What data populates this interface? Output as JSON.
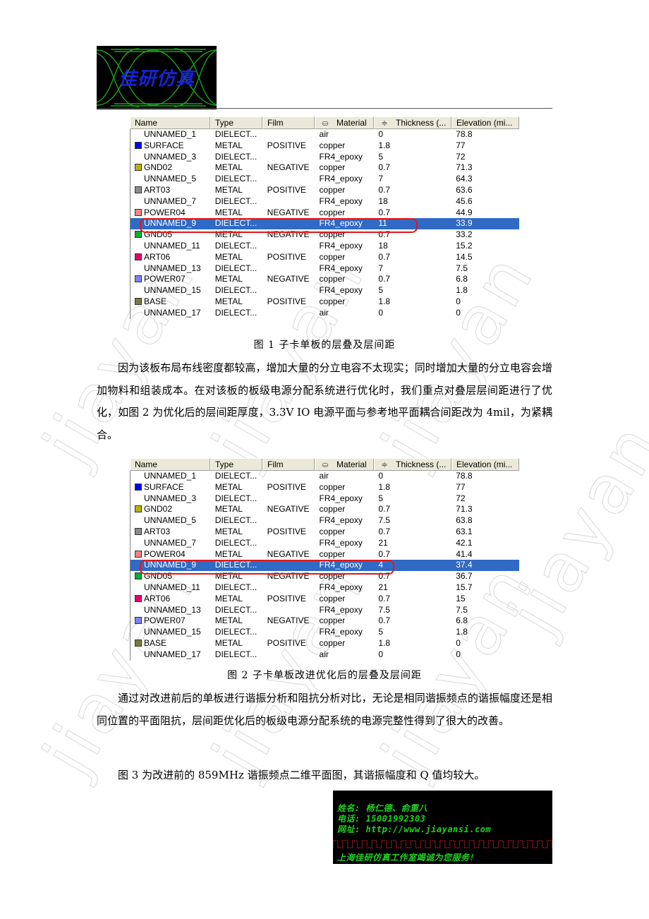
{
  "watermark": {
    "text": "jiayan",
    "color": "#d8d8d8"
  },
  "logo": {
    "text": "佳研仿真",
    "text_color": "#1a22d8",
    "curve_color": "#1fb51f"
  },
  "table_columns": {
    "name": "Name",
    "type": "Type",
    "film": "Film",
    "material": "Material",
    "material_icon": "paint-bucket-icon",
    "thickness": "Thickness (...",
    "thickness_icon": "layer-thickness-icon",
    "elevation": "Elevation (mi..."
  },
  "figure1": {
    "caption": "图 1  子卡单板的层叠及层间距",
    "selected_row": 8,
    "rows": [
      {
        "name": "UNNAMED_1",
        "type": "DIELECT...",
        "film": "",
        "material": "air",
        "thickness": "0",
        "elevation": "78.8",
        "color": ""
      },
      {
        "name": "SURFACE",
        "type": "METAL",
        "film": "POSITIVE",
        "material": "copper",
        "thickness": "1.8",
        "elevation": "77",
        "color": "#0000ff"
      },
      {
        "name": "UNNAMED_3",
        "type": "DIELECT...",
        "film": "",
        "material": "FR4_epoxy",
        "thickness": "5",
        "elevation": "72",
        "color": ""
      },
      {
        "name": "GND02",
        "type": "METAL",
        "film": "NEGATIVE",
        "material": "copper",
        "thickness": "0.7",
        "elevation": "71.3",
        "color": "#b5b500"
      },
      {
        "name": "UNNAMED_5",
        "type": "DIELECT...",
        "film": "",
        "material": "FR4_epoxy",
        "thickness": "7",
        "elevation": "64.3",
        "color": ""
      },
      {
        "name": "ART03",
        "type": "METAL",
        "film": "POSITIVE",
        "material": "copper",
        "thickness": "0.7",
        "elevation": "63.6",
        "color": "#8c8c8c"
      },
      {
        "name": "UNNAMED_7",
        "type": "DIELECT...",
        "film": "",
        "material": "FR4_epoxy",
        "thickness": "18",
        "elevation": "45.6",
        "color": ""
      },
      {
        "name": "POWER04",
        "type": "METAL",
        "film": "NEGATIVE",
        "material": "copper",
        "thickness": "0.7",
        "elevation": "44.9",
        "color": "#ff8080"
      },
      {
        "name": "UNNAMED_9",
        "type": "DIELECT...",
        "film": "",
        "material": "FR4_epoxy",
        "thickness": "11",
        "elevation": "33.9",
        "color": ""
      },
      {
        "name": "GND05",
        "type": "METAL",
        "film": "NEGATIVE",
        "material": "copper",
        "thickness": "0.7",
        "elevation": "33.2",
        "color": "#00b030"
      },
      {
        "name": "UNNAMED_11",
        "type": "DIELECT...",
        "film": "",
        "material": "FR4_epoxy",
        "thickness": "18",
        "elevation": "15.2",
        "color": ""
      },
      {
        "name": "ART06",
        "type": "METAL",
        "film": "POSITIVE",
        "material": "copper",
        "thickness": "0.7",
        "elevation": "14.5",
        "color": "#e8006c"
      },
      {
        "name": "UNNAMED_13",
        "type": "DIELECT...",
        "film": "",
        "material": "FR4_epoxy",
        "thickness": "7",
        "elevation": "7.5",
        "color": ""
      },
      {
        "name": "POWER07",
        "type": "METAL",
        "film": "NEGATIVE",
        "material": "copper",
        "thickness": "0.7",
        "elevation": "6.8",
        "color": "#8080ff"
      },
      {
        "name": "UNNAMED_15",
        "type": "DIELECT...",
        "film": "",
        "material": "FR4_epoxy",
        "thickness": "5",
        "elevation": "1.8",
        "color": ""
      },
      {
        "name": "BASE",
        "type": "METAL",
        "film": "POSITIVE",
        "material": "copper",
        "thickness": "1.8",
        "elevation": "0",
        "color": "#7a7a3a"
      },
      {
        "name": "UNNAMED_17",
        "type": "DIELECT...",
        "film": "",
        "material": "air",
        "thickness": "0",
        "elevation": "0",
        "color": ""
      }
    ]
  },
  "paragraph1": "因为该板布局布线密度都较高，增加大量的分立电容不太现实；同时增加大量的分立电容会增加物料和组装成本。在对该板的板级电源分配系统进行优化时，我们重点对叠层层间距进行了优化，如图 2 为优化后的层间距厚度，3.3V IO 电源平面与参考地平面耦合间距改为 4mil，为紧耦合。",
  "figure2": {
    "caption": "图 2  子卡单板改进优化后的层叠及层间距",
    "selected_row": 8,
    "rows": [
      {
        "name": "UNNAMED_1",
        "type": "DIELECT...",
        "film": "",
        "material": "air",
        "thickness": "0",
        "elevation": "78.8",
        "color": ""
      },
      {
        "name": "SURFACE",
        "type": "METAL",
        "film": "POSITIVE",
        "material": "copper",
        "thickness": "1.8",
        "elevation": "77",
        "color": "#0000ff"
      },
      {
        "name": "UNNAMED_3",
        "type": "DIELECT...",
        "film": "",
        "material": "FR4_epoxy",
        "thickness": "5",
        "elevation": "72",
        "color": ""
      },
      {
        "name": "GND02",
        "type": "METAL",
        "film": "NEGATIVE",
        "material": "copper",
        "thickness": "0.7",
        "elevation": "71.3",
        "color": "#b5b500"
      },
      {
        "name": "UNNAMED_5",
        "type": "DIELECT...",
        "film": "",
        "material": "FR4_epoxy",
        "thickness": "7.5",
        "elevation": "63.8",
        "color": ""
      },
      {
        "name": "ART03",
        "type": "METAL",
        "film": "POSITIVE",
        "material": "copper",
        "thickness": "0.7",
        "elevation": "63.1",
        "color": "#8c8c8c"
      },
      {
        "name": "UNNAMED_7",
        "type": "DIELECT...",
        "film": "",
        "material": "FR4_epoxy",
        "thickness": "21",
        "elevation": "42.1",
        "color": ""
      },
      {
        "name": "POWER04",
        "type": "METAL",
        "film": "NEGATIVE",
        "material": "copper",
        "thickness": "0.7",
        "elevation": "41.4",
        "color": "#ff8080"
      },
      {
        "name": "UNNAMED_9",
        "type": "DIELECT...",
        "film": "",
        "material": "FR4_epoxy",
        "thickness": "4",
        "elevation": "37.4",
        "color": ""
      },
      {
        "name": "GND05",
        "type": "METAL",
        "film": "NEGATIVE",
        "material": "copper",
        "thickness": "0.7",
        "elevation": "36.7",
        "color": "#00b030"
      },
      {
        "name": "UNNAMED_11",
        "type": "DIELECT...",
        "film": "",
        "material": "FR4_epoxy",
        "thickness": "21",
        "elevation": "15.7",
        "color": ""
      },
      {
        "name": "ART06",
        "type": "METAL",
        "film": "POSITIVE",
        "material": "copper",
        "thickness": "0.7",
        "elevation": "15",
        "color": "#e8006c"
      },
      {
        "name": "UNNAMED_13",
        "type": "DIELECT...",
        "film": "",
        "material": "FR4_epoxy",
        "thickness": "7.5",
        "elevation": "7.5",
        "color": ""
      },
      {
        "name": "POWER07",
        "type": "METAL",
        "film": "NEGATIVE",
        "material": "copper",
        "thickness": "0.7",
        "elevation": "6.8",
        "color": "#8080ff"
      },
      {
        "name": "UNNAMED_15",
        "type": "DIELECT...",
        "film": "",
        "material": "FR4_epoxy",
        "thickness": "5",
        "elevation": "1.8",
        "color": ""
      },
      {
        "name": "BASE",
        "type": "METAL",
        "film": "POSITIVE",
        "material": "copper",
        "thickness": "1.8",
        "elevation": "0",
        "color": "#7a7a3a"
      },
      {
        "name": "UNNAMED_17",
        "type": "DIELECT...",
        "film": "",
        "material": "air",
        "thickness": "0",
        "elevation": "0",
        "color": ""
      }
    ]
  },
  "paragraph2": "通过对改进前后的单板进行谐振分析和阻抗分析对比，无论是相同谐振频点的谐振幅度还是相同位置的平面阻抗，层间距优化后的板级电源分配系统的电源完整性得到了很大的改善。",
  "paragraph3": "图 3 为改进前的 859MHz 谐振频点二维平面图，其谐振幅度和 Q 值均较大。",
  "business_card": {
    "name_line": "姓名: 杨仁德、俞重八",
    "phone_line": "电话: 15001992303",
    "web_line": "网址: http://www.jiayansi.com",
    "slogan": "上海佳研仿真工作室竭诚为您服务!",
    "text_color": "#1fd21f",
    "wave_color": "#c02020"
  },
  "colors": {
    "selection": "#316ac5",
    "highlight_ring": "#e01818",
    "header_bg": "#ece9d8"
  }
}
